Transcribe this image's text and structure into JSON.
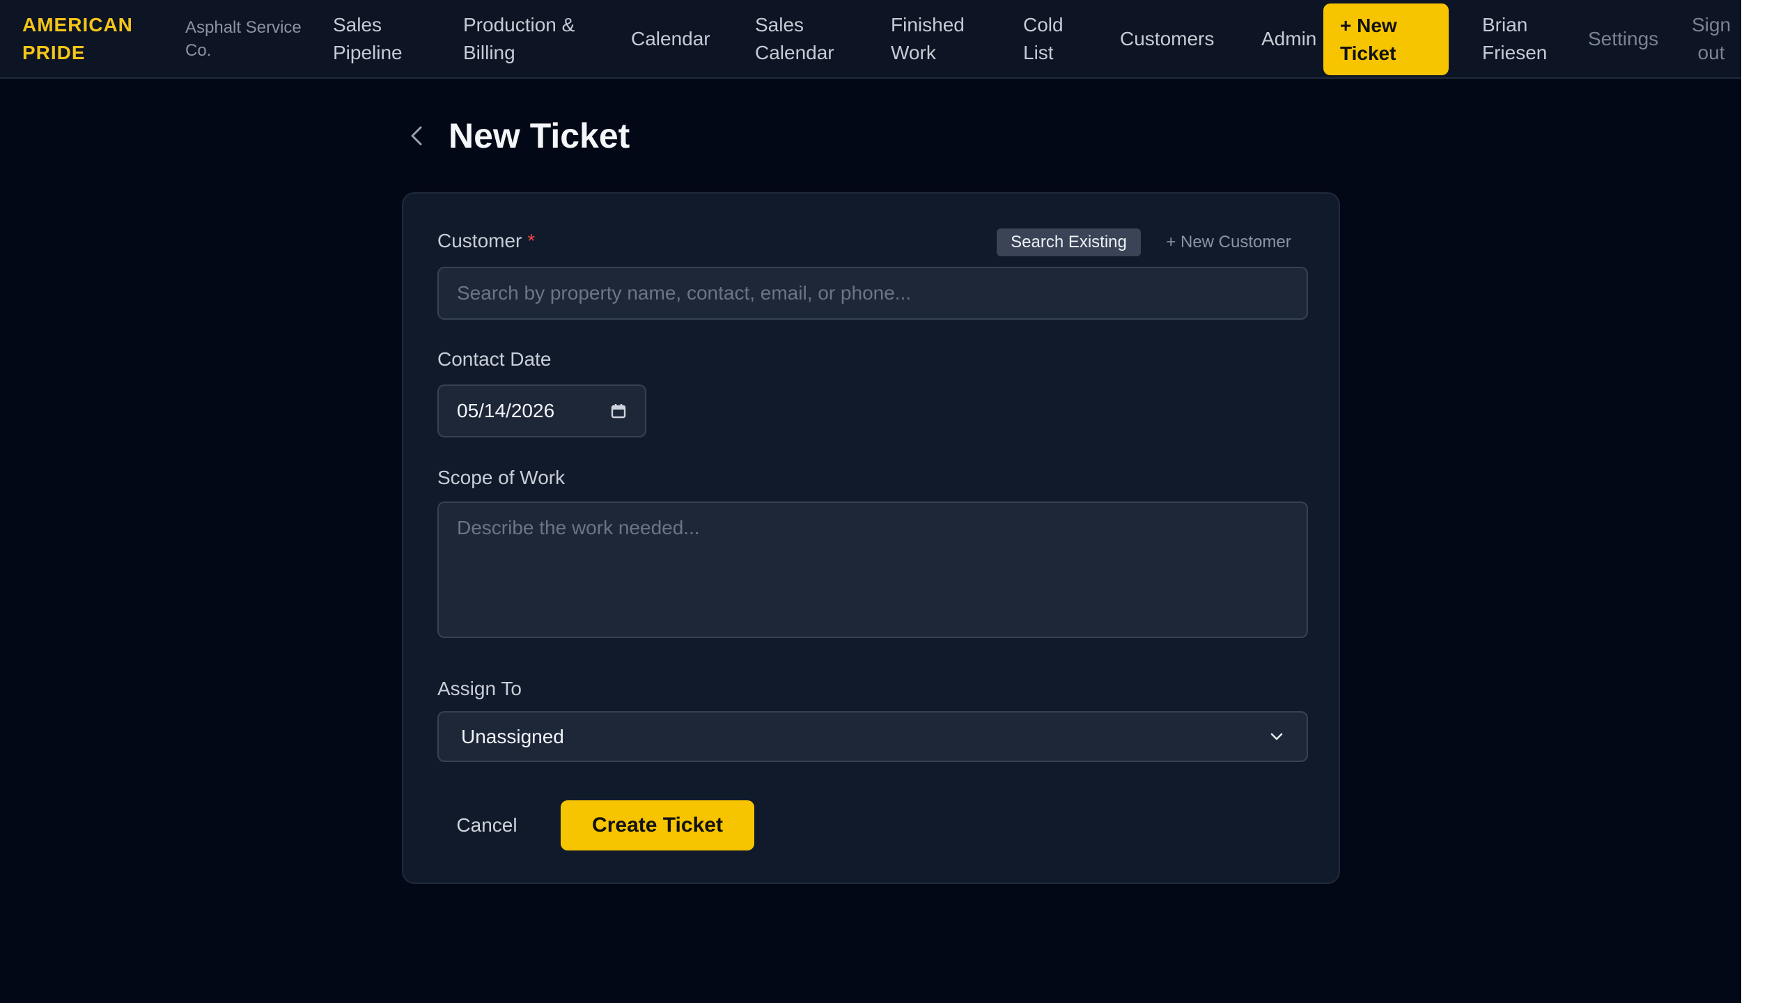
{
  "nav": {
    "brand": "AMERICAN PRIDE",
    "brand_sub": "Asphalt Service Co.",
    "links": [
      {
        "label": "Sales Pipeline"
      },
      {
        "label": "Production & Billing"
      },
      {
        "label": "Calendar"
      },
      {
        "label": "Sales Calendar"
      },
      {
        "label": "Finished Work"
      },
      {
        "label": "Cold List"
      },
      {
        "label": "Customers"
      },
      {
        "label": "Admin"
      }
    ],
    "new_ticket": "+ New Ticket",
    "user": "Brian Friesen",
    "settings": "Settings",
    "sign_out": "Sign out"
  },
  "page": {
    "title": "New Ticket",
    "back_icon": "chevron-left-icon"
  },
  "form": {
    "customer_label": "Customer",
    "required_mark": "*",
    "search_existing": "Search Existing",
    "new_customer": "+ New Customer",
    "customer_placeholder": "Search by property name, contact, email, or phone...",
    "contact_date_label": "Contact Date",
    "contact_date_value": "05/14/2026",
    "scope_label": "Scope of Work",
    "scope_placeholder": "Describe the work needed...",
    "assign_label": "Assign To",
    "assign_value": "Unassigned",
    "cancel": "Cancel",
    "create": "Create Ticket"
  },
  "colors": {
    "accent": "#f7c400",
    "background": "#030816",
    "card": "#111a2b",
    "required": "#ef4444"
  }
}
